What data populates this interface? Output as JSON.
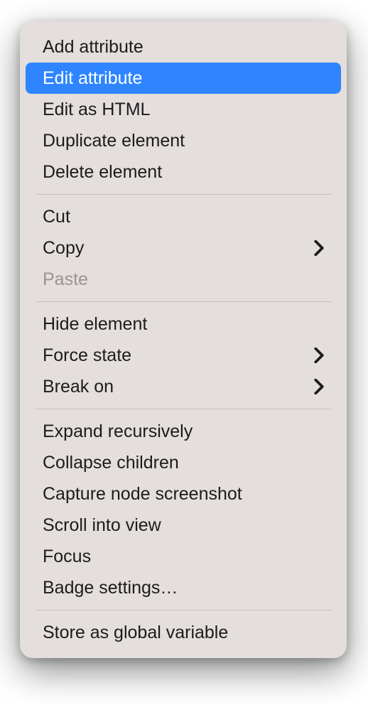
{
  "menu": {
    "groups": [
      [
        {
          "id": "add-attribute",
          "label": "Add attribute",
          "submenu": false,
          "highlighted": false,
          "disabled": false
        },
        {
          "id": "edit-attribute",
          "label": "Edit attribute",
          "submenu": false,
          "highlighted": true,
          "disabled": false
        },
        {
          "id": "edit-as-html",
          "label": "Edit as HTML",
          "submenu": false,
          "highlighted": false,
          "disabled": false
        },
        {
          "id": "duplicate-element",
          "label": "Duplicate element",
          "submenu": false,
          "highlighted": false,
          "disabled": false
        },
        {
          "id": "delete-element",
          "label": "Delete element",
          "submenu": false,
          "highlighted": false,
          "disabled": false
        }
      ],
      [
        {
          "id": "cut",
          "label": "Cut",
          "submenu": false,
          "highlighted": false,
          "disabled": false
        },
        {
          "id": "copy",
          "label": "Copy",
          "submenu": true,
          "highlighted": false,
          "disabled": false
        },
        {
          "id": "paste",
          "label": "Paste",
          "submenu": false,
          "highlighted": false,
          "disabled": true
        }
      ],
      [
        {
          "id": "hide-element",
          "label": "Hide element",
          "submenu": false,
          "highlighted": false,
          "disabled": false
        },
        {
          "id": "force-state",
          "label": "Force state",
          "submenu": true,
          "highlighted": false,
          "disabled": false
        },
        {
          "id": "break-on",
          "label": "Break on",
          "submenu": true,
          "highlighted": false,
          "disabled": false
        }
      ],
      [
        {
          "id": "expand-recursively",
          "label": "Expand recursively",
          "submenu": false,
          "highlighted": false,
          "disabled": false
        },
        {
          "id": "collapse-children",
          "label": "Collapse children",
          "submenu": false,
          "highlighted": false,
          "disabled": false
        },
        {
          "id": "capture-node-screenshot",
          "label": "Capture node screenshot",
          "submenu": false,
          "highlighted": false,
          "disabled": false
        },
        {
          "id": "scroll-into-view",
          "label": "Scroll into view",
          "submenu": false,
          "highlighted": false,
          "disabled": false
        },
        {
          "id": "focus",
          "label": "Focus",
          "submenu": false,
          "highlighted": false,
          "disabled": false
        },
        {
          "id": "badge-settings",
          "label": "Badge settings…",
          "submenu": false,
          "highlighted": false,
          "disabled": false
        }
      ],
      [
        {
          "id": "store-as-global-variable",
          "label": "Store as global variable",
          "submenu": false,
          "highlighted": false,
          "disabled": false
        }
      ]
    ]
  },
  "colors": {
    "menu_bg": "#e4dedd",
    "highlight": "#2e85ff",
    "text": "#1c1c1c",
    "disabled_text": "#9a9493",
    "divider": "#c6c0bf"
  }
}
